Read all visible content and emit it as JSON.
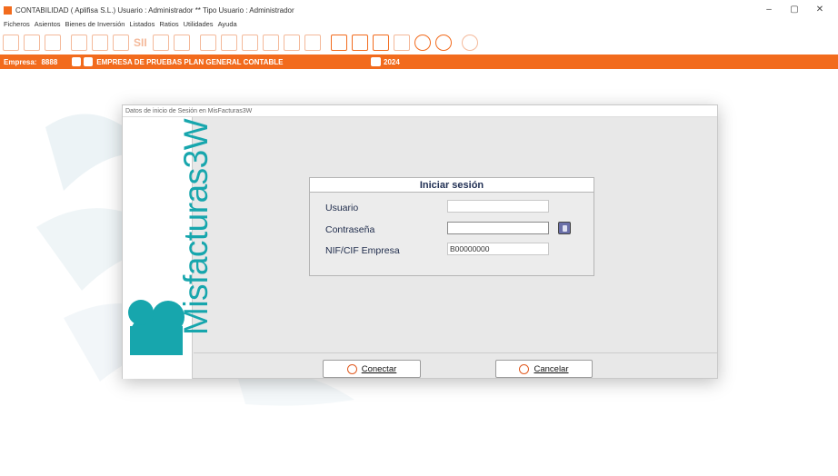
{
  "window": {
    "title": "CONTABILIDAD  ( Aplifisa S.L.)  Usuario : Administrador  **  Tipo Usuario : Administrador",
    "controls": [
      "–",
      "▢",
      "✕"
    ]
  },
  "menu": [
    "Ficheros",
    "Asientos",
    "Bienes de Inversión",
    "Listados",
    "Ratios",
    "Utilidades",
    "Ayuda"
  ],
  "toolbar": {
    "sii_label": "SII"
  },
  "company_bar": {
    "label": "Empresa:",
    "number": "8888",
    "name": "EMPRESA DE PRUEBAS PLAN GENERAL CONTABLE",
    "year": "2024"
  },
  "dialog": {
    "title": "Datos de inicio de Sesión en MisFacturas3W",
    "brand": "Misfacturas3W",
    "panel_title": "Iniciar sesión",
    "fields": [
      {
        "label": "Usuario",
        "value": ""
      },
      {
        "label": "Contraseña",
        "value": ""
      },
      {
        "label": "NIF/CIF Empresa",
        "value": "B00000000"
      }
    ],
    "connect_label": "Conectar",
    "cancel_label": "Cancelar"
  },
  "colors": {
    "accent": "#f26b1d",
    "brand_teal": "#17a6ad"
  }
}
